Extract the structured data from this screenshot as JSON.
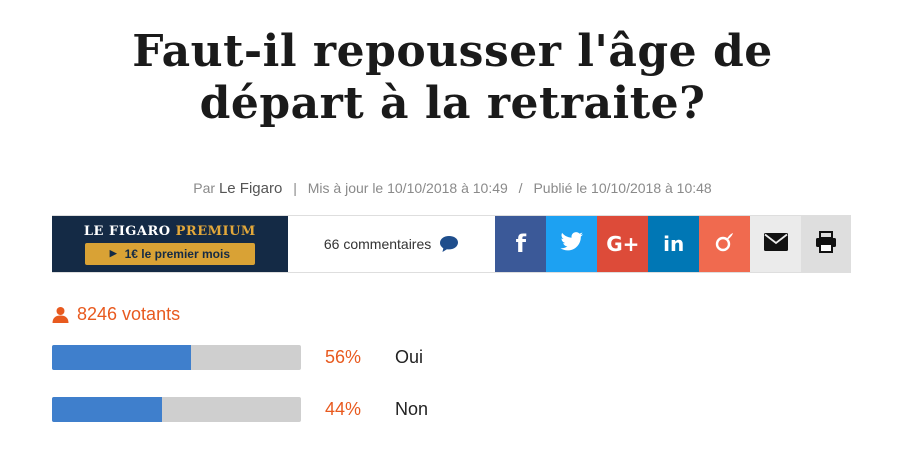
{
  "article": {
    "title_line1": "Faut-il repousser l'âge de",
    "title_line2": "départ à la retraite?"
  },
  "meta": {
    "by": "Par",
    "author": "Le Figaro",
    "updated": "Mis à jour le 10/10/2018 à 10:49",
    "separator": "/",
    "published": "Publié le 10/10/2018 à 10:48"
  },
  "premium": {
    "brand": "LE FIGARO",
    "brand_accent": "PREMIUM",
    "offer": "1€ le premier mois"
  },
  "comments": {
    "label": "66 commentaires"
  },
  "share_buttons": [
    {
      "name": "facebook",
      "glyph": "f",
      "color": "#3b5998"
    },
    {
      "name": "twitter",
      "icon": "twitter-icon",
      "color": "#1da1f2"
    },
    {
      "name": "google-plus",
      "glyph": "G+",
      "color": "#dd4b39"
    },
    {
      "name": "linkedin",
      "glyph": "in",
      "color": "#0077b5"
    },
    {
      "name": "viadeo",
      "icon": "viadeo-icon",
      "color": "#f06a4f"
    },
    {
      "name": "email",
      "icon": "mail-icon",
      "color": "#ebebeb"
    },
    {
      "name": "print",
      "icon": "print-icon",
      "color": "#dedede"
    }
  ],
  "poll": {
    "voters": "8246 votants",
    "options": [
      {
        "percent_label": "56%",
        "percent": 56,
        "answer": "Oui"
      },
      {
        "percent_label": "44%",
        "percent": 44,
        "answer": "Non"
      }
    ],
    "bar_color": "#3f7fcc",
    "accent_color": "#e85a1f"
  }
}
